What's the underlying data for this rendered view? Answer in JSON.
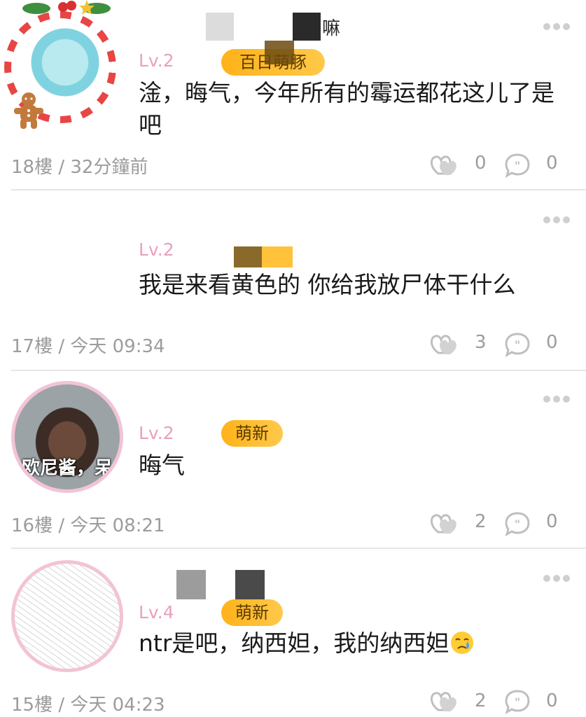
{
  "comments": [
    {
      "username_suffix": "嘛",
      "level": "Lv.2",
      "badge": "百日萌豚",
      "text": "淦，晦气，今年所有的霉运都花这儿了是吧",
      "floor_time": "18樓 / 32分鐘前",
      "likes": "0",
      "replies": "0",
      "avatar": "christmas-anime-avatar"
    },
    {
      "level": "Lv.2",
      "badge": "",
      "text": "我是来看黄色的 你给我放尸体干什么",
      "floor_time": "17樓 / 今天 09:34",
      "likes": "3",
      "replies": "0",
      "avatar": "none"
    },
    {
      "level": "Lv.2",
      "badge": "萌新",
      "text": "晦气",
      "floor_time": "16樓 / 今天 08:21",
      "likes": "2",
      "replies": "0",
      "avatar": "crying-man-avatar",
      "avatar_caption": "欧尼酱，呆"
    },
    {
      "level": "Lv.4",
      "badge": "萌新",
      "text": "ntr是吧，纳西妲，我的纳西妲",
      "text_emoji": "crying-face-emoji",
      "floor_time": "15樓 / 今天 04:23",
      "likes": "2",
      "replies": "0",
      "avatar": "sketch-anime-avatar"
    }
  ],
  "colors": {
    "level": "#e9a0bf",
    "badge": "#ffb21a",
    "meta": "#9c9c9c",
    "divider": "#e6e6e6"
  }
}
